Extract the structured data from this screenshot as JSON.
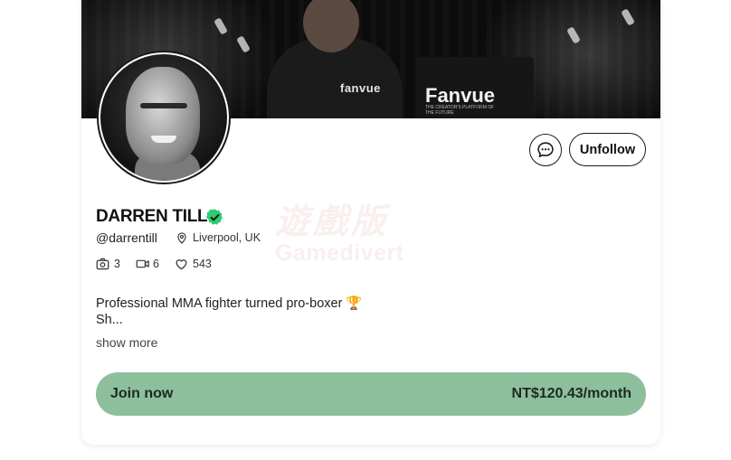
{
  "banner": {
    "shirt_brand": "fanvue",
    "podium_brand": "Fanvue",
    "podium_tagline": "THE CREATOR'S PLATFORM OF THE FUTURE"
  },
  "profile": {
    "name": "DARREN TILL",
    "verified": true,
    "handle": "@darrentill",
    "location": "Liverpool, UK",
    "stats": {
      "photos": "3",
      "videos": "6",
      "likes": "543"
    },
    "bio_line1": "Professional MMA fighter turned pro-boxer 🏆",
    "bio_line2": "Sh...",
    "show_more_label": "show more"
  },
  "actions": {
    "message_icon": "chat-bubble-icon",
    "unfollow_label": "Unfollow"
  },
  "subscription": {
    "join_label": "Join now",
    "price": "NT$120.43/month"
  },
  "watermark": {
    "top_text": "遊戲版",
    "bottom_text": "Gamedivert"
  },
  "colors": {
    "accent_green": "#8dbf9c",
    "verified_green": "#2ecc71"
  }
}
